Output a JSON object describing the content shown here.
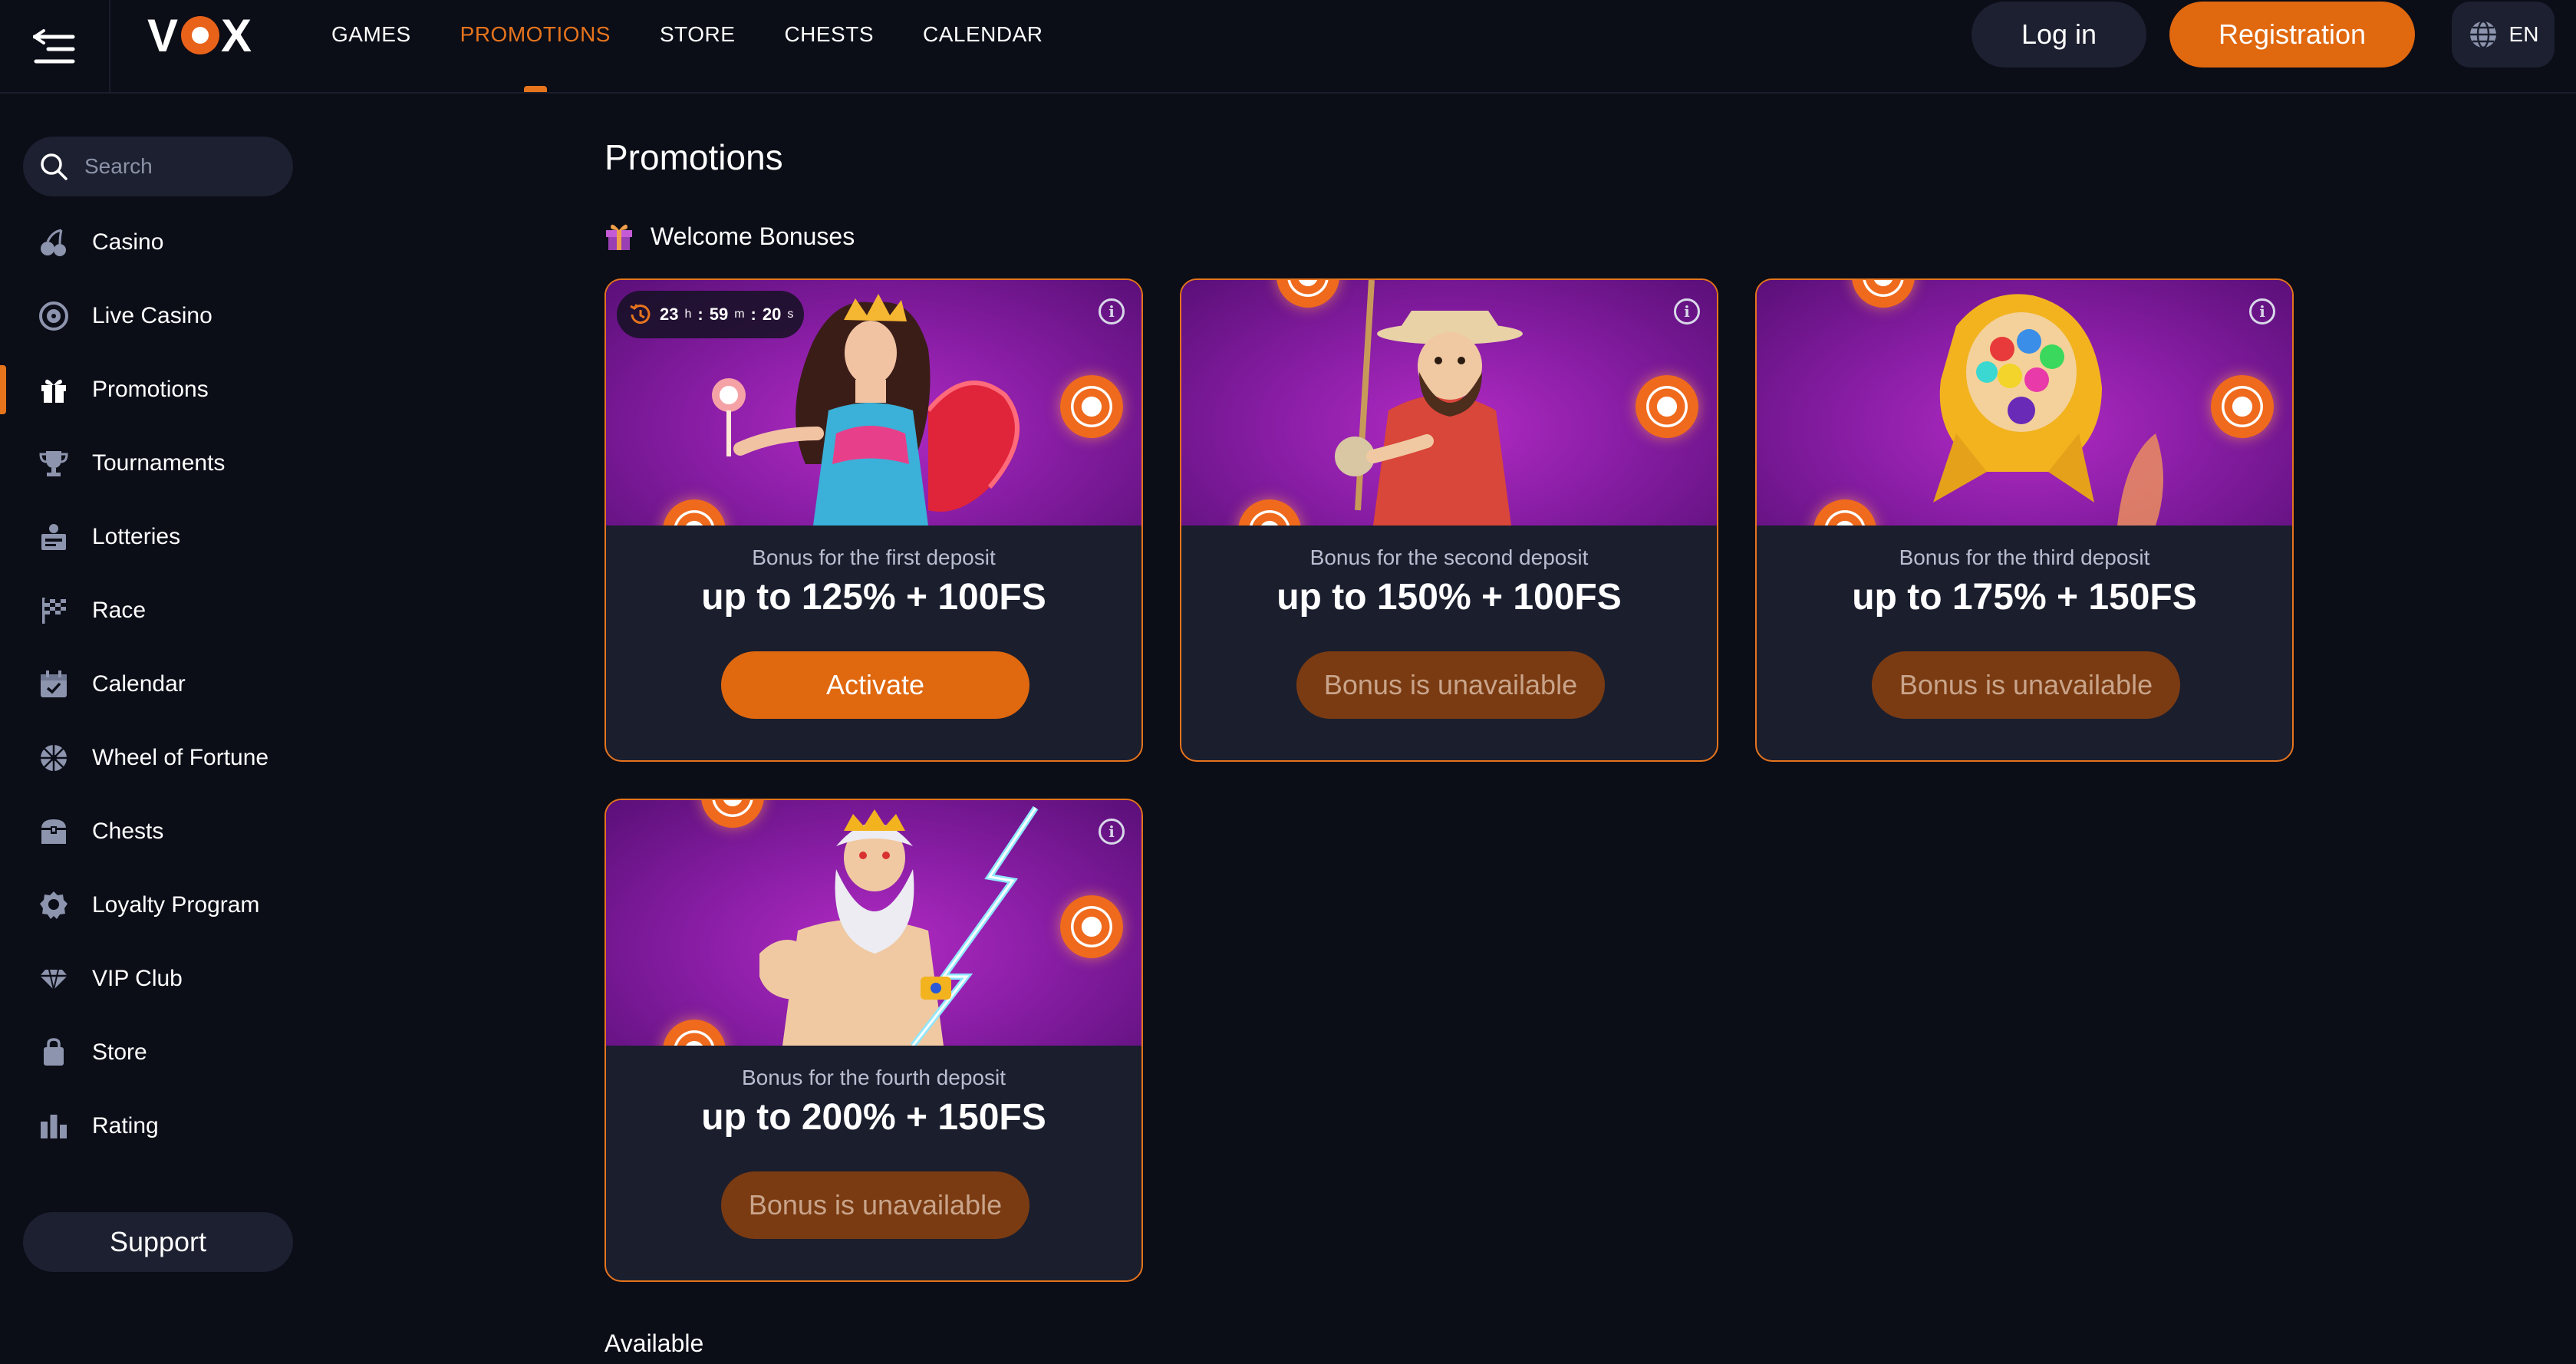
{
  "header": {
    "logo": "VOX",
    "nav": [
      "GAMES",
      "PROMOTIONS",
      "STORE",
      "CHESTS",
      "CALENDAR"
    ],
    "active_nav": "PROMOTIONS",
    "login": "Log in",
    "register": "Registration",
    "lang": "EN"
  },
  "sidebar": {
    "search_placeholder": "Search",
    "items": [
      {
        "label": "Casino",
        "icon": "cherries-icon"
      },
      {
        "label": "Live Casino",
        "icon": "roulette-icon"
      },
      {
        "label": "Promotions",
        "icon": "gift-icon"
      },
      {
        "label": "Tournaments",
        "icon": "trophy-icon"
      },
      {
        "label": "Lotteries",
        "icon": "lottery-icon"
      },
      {
        "label": "Race",
        "icon": "flag-icon"
      },
      {
        "label": "Calendar",
        "icon": "calendar-icon"
      },
      {
        "label": "Wheel of Fortune",
        "icon": "wheel-icon"
      },
      {
        "label": "Chests",
        "icon": "chest-icon"
      },
      {
        "label": "Loyalty Program",
        "icon": "badge-icon"
      },
      {
        "label": "VIP Club",
        "icon": "diamond-icon"
      },
      {
        "label": "Store",
        "icon": "bag-icon"
      },
      {
        "label": "Rating",
        "icon": "rating-icon"
      }
    ],
    "active": "Promotions",
    "support": "Support"
  },
  "main": {
    "title": "Promotions",
    "section": "Welcome Bonuses",
    "timer": {
      "h": "23",
      "m": "59",
      "s": "20",
      "h_unit": "h",
      "m_unit": "m",
      "s_unit": "s"
    },
    "cards": [
      {
        "subtitle": "Bonus for the first deposit",
        "amount": "up to 125% + 100FS",
        "button": "Activate",
        "enabled": true,
        "art": "sweet-queen"
      },
      {
        "subtitle": "Bonus for the second deposit",
        "amount": "up to 150% + 100FS",
        "button": "Bonus is unavailable",
        "enabled": false,
        "art": "fisherman"
      },
      {
        "subtitle": "Bonus for the third deposit",
        "amount": "up to 175% + 150FS",
        "button": "Bonus is unavailable",
        "enabled": false,
        "art": "candy-rocket"
      },
      {
        "subtitle": "Bonus for the fourth deposit",
        "amount": "up to 200% + 150FS",
        "button": "Bonus is unavailable",
        "enabled": false,
        "art": "zeus"
      }
    ],
    "available": "Available"
  },
  "colors": {
    "accent": "#e5741d",
    "bg": "#0b0d17",
    "panel": "#1c2030",
    "card": "#1b1e2d",
    "banner": "#8a1ea6"
  }
}
